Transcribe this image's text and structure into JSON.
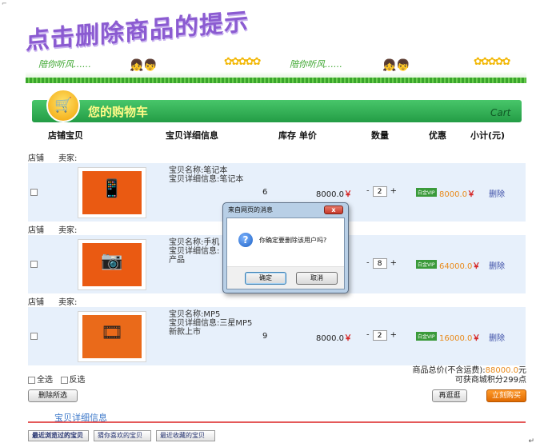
{
  "page_title": "点击删除商品的提示",
  "banner": {
    "tagline": "陪你听风……",
    "sunflowers": "✿✿✿✿✿"
  },
  "cart_header": {
    "label": "您的购物车",
    "english": "Cart"
  },
  "columns": [
    "店铺宝贝",
    "宝贝详细信息",
    "库存 单价",
    "数量",
    "优惠",
    "小计(元)"
  ],
  "shop_label": "店铺",
  "seller_label": "卖家:",
  "items": [
    {
      "name": "宝贝名称:笔记本",
      "detail": "宝贝详细信息:笔记本",
      "stock": "6",
      "price": "8000.0",
      "qty": "2",
      "vip": "白金VIP",
      "subtotal": "8000.0",
      "delete": "删除",
      "glyph": "📱"
    },
    {
      "name": "宝贝名称:手机",
      "detail": "宝贝详细信息:",
      "detail2": "产品",
      "stock": "",
      "price": "",
      "qty": "8",
      "vip": "白金VIP",
      "subtotal": "64000.0",
      "delete": "删除",
      "glyph": "📷"
    },
    {
      "name": "宝贝名称:MP5",
      "detail": "宝贝详细信息:三星MP5新款上市",
      "stock": "9",
      "price": "8000.0",
      "qty": "2",
      "vip": "白金VIP",
      "subtotal": "16000.0",
      "delete": "删除",
      "glyph": "🎞"
    }
  ],
  "currency_symbol": "￥",
  "qty_minus": "-",
  "qty_plus": "+",
  "footer": {
    "select_all": "全选",
    "invert": "反选",
    "delete_selected": "删除所选",
    "total_label": "商品总价(不含运费):",
    "total_value": "88000.0",
    "total_unit": "元",
    "points": "可获商城积分299点",
    "continue_btn": "再逛逛",
    "buy_btn": "立刻购买"
  },
  "detail_section_title": "宝贝详细信息",
  "tabs": [
    "最近浏览过的宝贝",
    "猜你喜欢的宝贝",
    "最近收藏的宝贝"
  ],
  "dialog": {
    "title": "来自网页的消息",
    "close": "x",
    "message": "你确定要删除该用户吗?",
    "ok": "确定",
    "cancel": "取消"
  },
  "colors": {
    "title_purple": "#8b5bd1",
    "cart_green": "#239c45",
    "price_red": "#d62b2b",
    "subtotal_orange": "#e88a1b",
    "delete_blue": "#3b4da6"
  }
}
